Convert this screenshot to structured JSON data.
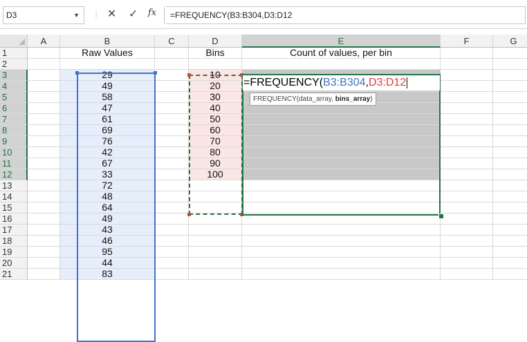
{
  "formula_bar": {
    "name_box": "D3",
    "cancel_glyph": "✕",
    "enter_glyph": "✓",
    "fx_label": "fx",
    "formula": "=FREQUENCY(B3:B304,D3:D12"
  },
  "columns": [
    "A",
    "B",
    "C",
    "D",
    "E",
    "F",
    "G"
  ],
  "rows": [
    "1",
    "2",
    "3",
    "4",
    "5",
    "6",
    "7",
    "8",
    "9",
    "10",
    "11",
    "12",
    "13",
    "14",
    "15",
    "16",
    "17",
    "18",
    "19",
    "20",
    "21"
  ],
  "headers": {
    "B1": "Raw Values",
    "D1": "Bins",
    "E1": "Count of values, per bin"
  },
  "raw_values": [
    29,
    49,
    58,
    47,
    61,
    69,
    76,
    42,
    67,
    33,
    72,
    48,
    64,
    49,
    43,
    46,
    95,
    44,
    83
  ],
  "bins": [
    10,
    20,
    30,
    40,
    50,
    60,
    70,
    80,
    90,
    100
  ],
  "editing": {
    "prefix": "=FREQUENCY(",
    "arg1": "B3:B304",
    "comma": ",",
    "arg2": "D3:D12",
    "tooltip_func": "FREQUENCY(data_array, ",
    "tooltip_bold": "bins_array",
    "tooltip_close": ")"
  },
  "colors": {
    "arg1": "#4472c4",
    "arg2": "#e03c3c",
    "selection": "#217346"
  }
}
